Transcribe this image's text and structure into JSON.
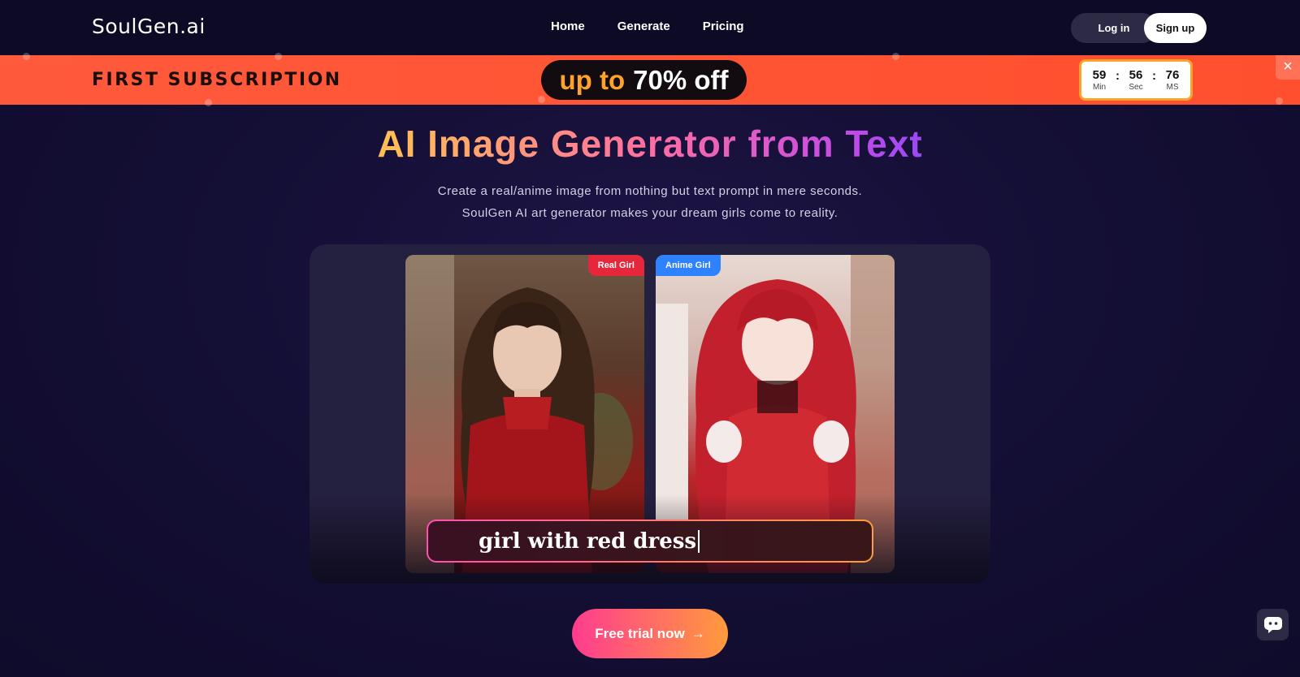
{
  "header": {
    "logo_main": "SoulGen",
    "logo_suffix": ".ai",
    "nav": [
      "Home",
      "Generate",
      "Pricing"
    ],
    "login_label": "Log in",
    "signup_label": "Sign up"
  },
  "promo": {
    "title": "FIRST SUBSCRIPTION",
    "pill_up": "up to",
    "pill_off": "70% off",
    "timer": {
      "min": "59",
      "min_label": "Min",
      "sec": "56",
      "sec_label": "Sec",
      "ms": "76",
      "ms_label": "MS"
    },
    "close_glyph": "×"
  },
  "hero": {
    "title": "AI Image Generator from Text",
    "subtitle_line1": "Create a real/anime image from nothing but text prompt in mere seconds.",
    "subtitle_line2": "SoulGen AI art generator makes your dream girls come to reality."
  },
  "showcase": {
    "real_badge": "Real Girl",
    "anime_badge": "Anime Girl",
    "prompt_text": "girl with red dress"
  },
  "cta": {
    "label": "Free trial now",
    "arrow": "→"
  },
  "colors": {
    "banner": "#ff5a3c",
    "accent_orange": "#ffa22b",
    "real_badge": "#e5273c",
    "anime_badge": "#2e82ff"
  }
}
